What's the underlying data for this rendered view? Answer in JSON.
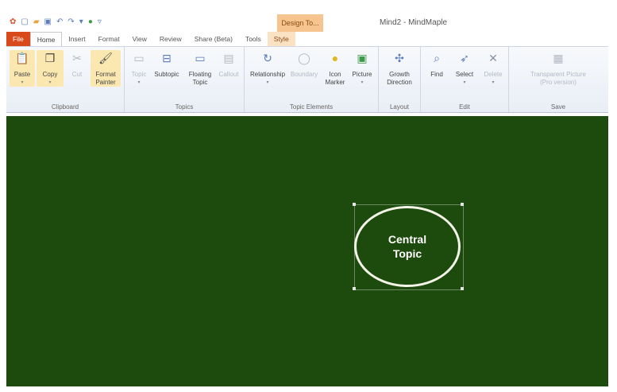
{
  "window": {
    "title": "Mind2 - MindMaple",
    "context_tab_group": "Design To..."
  },
  "tabs": [
    "File",
    "Home",
    "Insert",
    "Format",
    "View",
    "Review",
    "Share (Beta)",
    "Tools",
    "Style"
  ],
  "ribbon": {
    "clipboard": {
      "label": "Clipboard",
      "paste": "Paste",
      "copy": "Copy",
      "cut": "Cut",
      "format_painter_1": "Format",
      "format_painter_2": "Painter"
    },
    "topics": {
      "label": "Topics",
      "topic": "Topic",
      "subtopic": "Subtopic",
      "floating_1": "Floating",
      "floating_2": "Topic",
      "callout": "Callout"
    },
    "topic_elements": {
      "label": "Topic Elements",
      "relationship": "Relationship",
      "boundary": "Boundary",
      "icon_marker_1": "Icon",
      "icon_marker_2": "Marker",
      "picture": "Picture"
    },
    "layout": {
      "label": "Layout",
      "growth_1": "Growth",
      "growth_2": "Direction"
    },
    "edit": {
      "label": "Edit",
      "find": "Find",
      "select": "Select",
      "delete": "Delete"
    },
    "save": {
      "label": "Save",
      "transparent_1": "Transparent Picture",
      "transparent_2": "(Pro version)"
    }
  },
  "canvas": {
    "central_topic_line1": "Central",
    "central_topic_line2": "Topic"
  },
  "colors": {
    "canvas_bg": "#1d4a0d",
    "file_tab": "#d84a1b",
    "context_tab": "#f5c48f"
  }
}
